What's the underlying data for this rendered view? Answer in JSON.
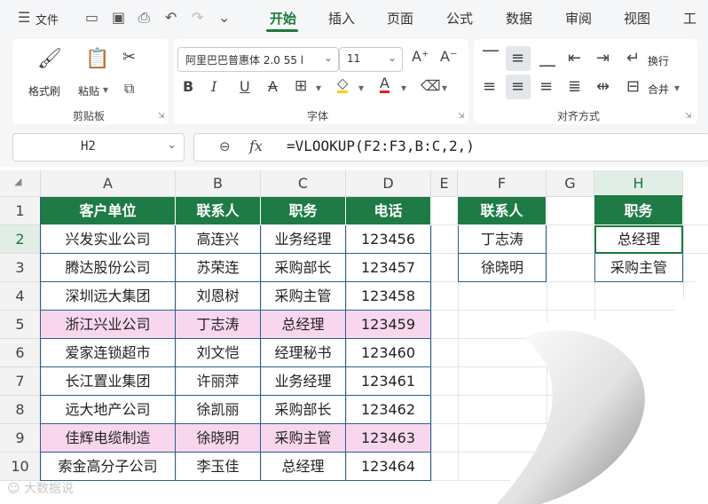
{
  "menu": {
    "file": "文件",
    "tabs": [
      "开始",
      "插入",
      "页面",
      "公式",
      "数据",
      "审阅",
      "视图",
      "工"
    ]
  },
  "ribbon": {
    "format_painter": "格式刷",
    "paste": "粘贴",
    "clipboard_group": "剪贴板",
    "font_name": "阿里巴巴普惠体 2.0 55 l",
    "font_size": "11",
    "font_group": "字体",
    "wrap": "换行",
    "merge": "合并",
    "align_group": "对齐方式"
  },
  "formula_bar": {
    "name_box": "H2",
    "fx": "fx",
    "formula": "=VLOOKUP(F2:F3,B:C,2,)"
  },
  "columns": [
    "A",
    "B",
    "C",
    "D",
    "E",
    "F",
    "G",
    "H"
  ],
  "rows": [
    "1",
    "2",
    "3",
    "4",
    "5",
    "6",
    "7",
    "8",
    "9",
    "10"
  ],
  "table": {
    "headers": [
      "客户单位",
      "联系人",
      "职务",
      "电话"
    ],
    "data": [
      [
        "兴发实业公司",
        "高连兴",
        "业务经理",
        "123456"
      ],
      [
        "腾达股份公司",
        "苏荣连",
        "采购部长",
        "123457"
      ],
      [
        "深圳远大集团",
        "刘恩树",
        "采购主管",
        "123458"
      ],
      [
        "浙江兴业公司",
        "丁志涛",
        "总经理",
        "123459"
      ],
      [
        "爱家连锁超市",
        "刘文恺",
        "经理秘书",
        "123460"
      ],
      [
        "长江置业集团",
        "许丽萍",
        "业务经理",
        "123461"
      ],
      [
        "远大地产公司",
        "徐凯丽",
        "采购部长",
        "123462"
      ],
      [
        "佳辉电缆制造",
        "徐晓明",
        "采购主管",
        "123463"
      ],
      [
        "索金高分子公司",
        "李玉佳",
        "总经理",
        "123464"
      ]
    ]
  },
  "lookup": {
    "f_header": "联系人",
    "f_values": [
      "丁志涛",
      "徐晓明"
    ],
    "h_header": "职务",
    "h_values": [
      "总经理",
      "采购主管"
    ]
  },
  "watermark": "大数据说",
  "colors": {
    "accent": "#1a7a3a",
    "header_fill": "#1e7b46",
    "highlight_fill": "#f8d7ee"
  }
}
